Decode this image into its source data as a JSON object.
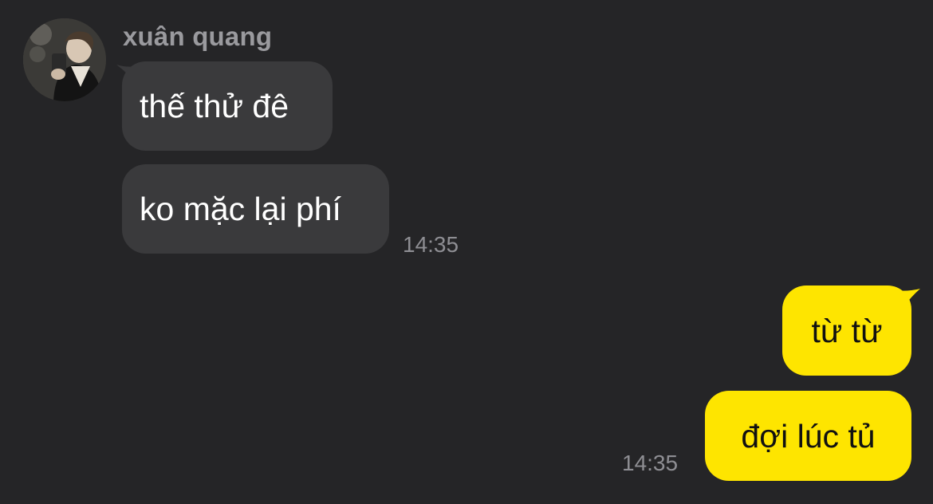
{
  "incoming": {
    "sender_name": "xuân quang",
    "messages": [
      {
        "text": "thế thử đê"
      },
      {
        "text": "ko mặc lại phí"
      }
    ],
    "time": "14:35"
  },
  "outgoing": {
    "messages": [
      {
        "text": "từ từ"
      },
      {
        "text": "đợi lúc tủ"
      }
    ],
    "time": "14:35"
  },
  "colors": {
    "background": "#252527",
    "incoming_bubble": "#3a3a3c",
    "outgoing_bubble": "#fee500",
    "timestamp": "#8e8e93",
    "sender_name": "#9a9a9e"
  }
}
